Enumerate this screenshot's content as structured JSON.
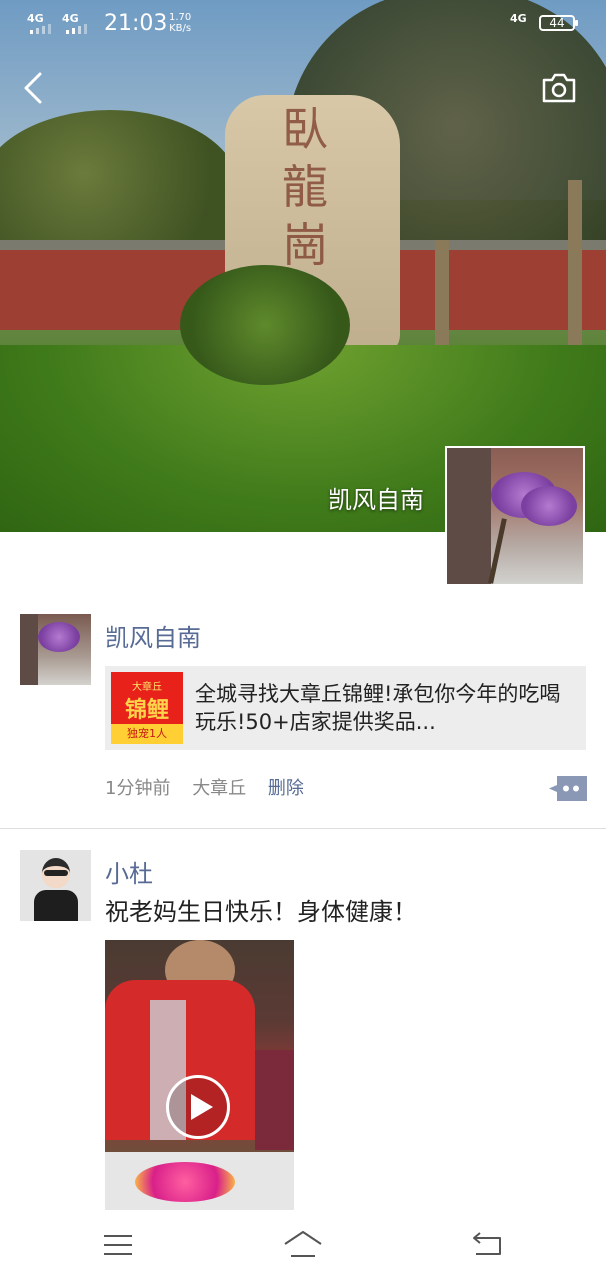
{
  "status_bar": {
    "signal1": "4G",
    "signal2": "4G",
    "time": "21:03",
    "speed_value": "1.70",
    "speed_unit": "KB/s",
    "net_type": "4G",
    "battery": "44"
  },
  "cover": {
    "stone_text": "臥龍崗",
    "name": "凯风自南"
  },
  "feed": [
    {
      "name": "凯风自南",
      "share": {
        "thumb_top": "大章丘",
        "thumb_main": "锦鲤",
        "thumb_bottom": "独宠1人",
        "title": "全城寻找大章丘锦鲤!承包你今年的吃喝玩乐!50+店家提供奖品..."
      },
      "time": "1分钟前",
      "location": "大章丘",
      "delete_label": "删除"
    },
    {
      "name": "小杜",
      "text": "祝老妈生日快乐！身体健康！"
    }
  ],
  "icons": {
    "back": "chevron-left-icon",
    "camera": "camera-icon",
    "more": "comment-more-icon",
    "menu": "menu-icon",
    "home": "home-icon",
    "return": "return-icon",
    "play": "play-icon"
  },
  "colors": {
    "link": "#576b95",
    "text": "#222222",
    "meta": "#888888"
  }
}
